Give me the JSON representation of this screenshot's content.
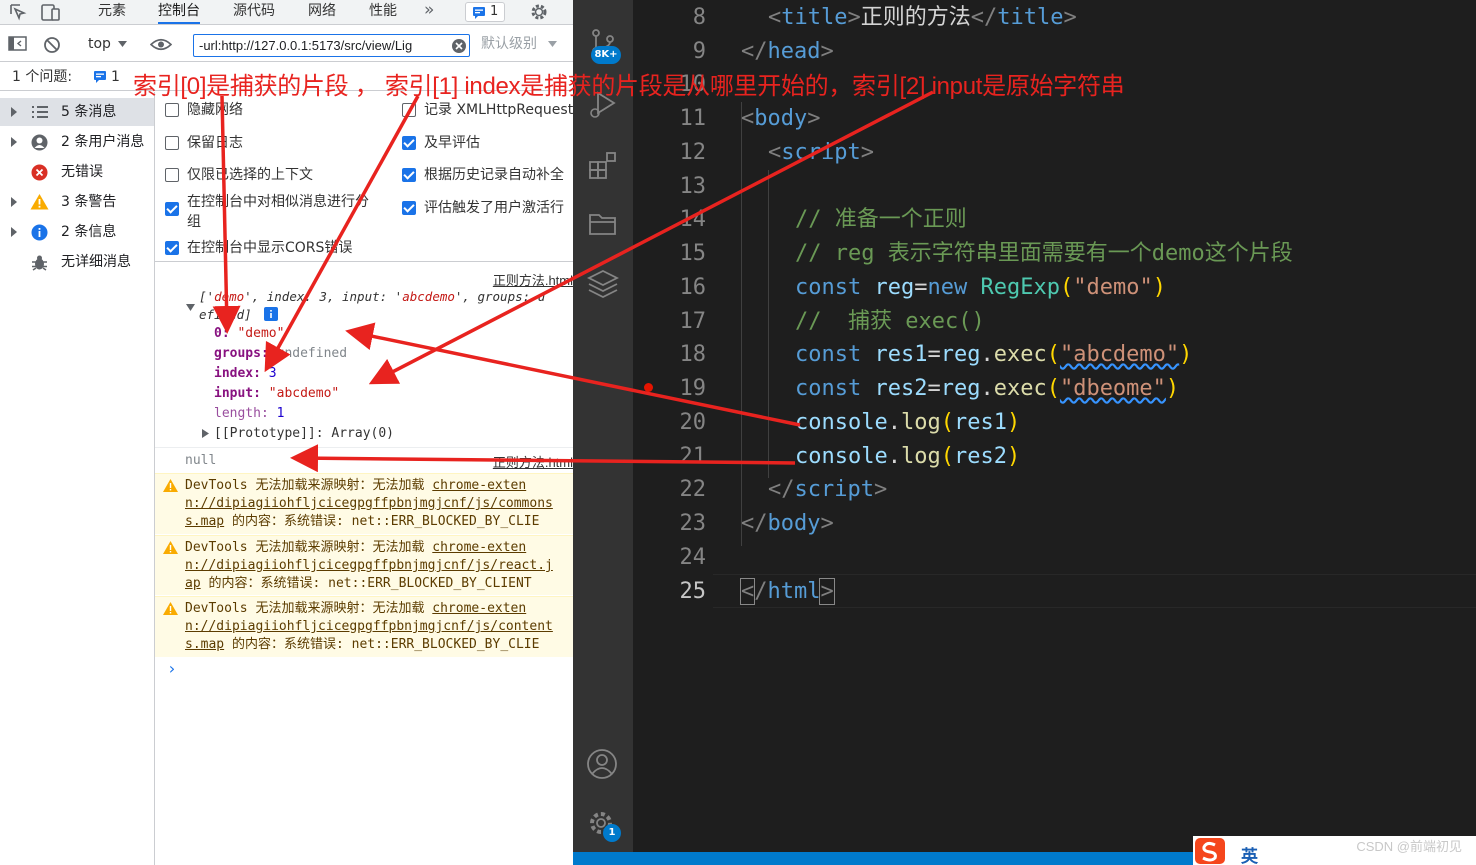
{
  "devtools": {
    "tabs": [
      {
        "label": "元素"
      },
      {
        "label": "控制台",
        "active": true
      },
      {
        "label": "源代码"
      },
      {
        "label": "网络"
      },
      {
        "label": "性能"
      }
    ],
    "more_tabs": "»",
    "issues_badge_count": "1",
    "toolbar": {
      "context": "top",
      "filter_value": "-url:http://127.0.0.1:5173/src/view/Lig",
      "level": "默认级别"
    },
    "issues_bar": {
      "label": "1 个问题:",
      "count": "1"
    },
    "sidebar": [
      {
        "label": "5 条消息",
        "icon": "list-icon",
        "selected": true
      },
      {
        "label": "2 条用户消息",
        "icon": "user-icon"
      },
      {
        "label": "无错误",
        "icon": "error-icon"
      },
      {
        "label": "3 条警告",
        "icon": "warning-icon"
      },
      {
        "label": "2 条信息",
        "icon": "info-icon"
      },
      {
        "label": "无详细消息",
        "icon": "bug-icon"
      }
    ],
    "settings": {
      "hide_network": "隐藏网络",
      "log_xhr": "记录 XMLHttpRequest",
      "preserve_log": "保留日志",
      "eager_eval": "及早评估",
      "selected_context": "仅限已选择的上下文",
      "autocomplete": "根据历史记录自动补全",
      "group_similar_1": "在控制台中对相似消息进行分",
      "group_similar_2": "组",
      "user_activation": "评估触发了用户激活行",
      "show_cors": "在控制台中显示CORS错误"
    },
    "console": {
      "source_link": "正则方法.html",
      "summary_prefix": "['",
      "summary_demo": "demo",
      "summary_mid": "', index: 3, input: '",
      "summary_input": "abcdemo",
      "summary_rest": "', groups: u",
      "summary_cont": "efined]",
      "props": [
        {
          "key": "0",
          "value": "\"demo\""
        },
        {
          "key": "groups",
          "value": "undefined"
        },
        {
          "key": "index",
          "value": "3"
        },
        {
          "key": "input",
          "value": "\"abcdemo\""
        },
        {
          "key": "length",
          "value": "1"
        }
      ],
      "prototype": "[[Prototype]]: Array(0)",
      "null_line": "null",
      "warnings": [
        {
          "line1_text": "DevTools 无法加载来源映射：无法加载 ",
          "line1_link": "chrome-exten",
          "line2": "n://dipiagiiohfljcicegpgffpbnjmgjcnf/js/commons",
          "line3_link": "s.map",
          "line3_text": " 的内容：系统错误: net::ERR_BLOCKED_BY_CLIE"
        },
        {
          "line1_text": "DevTools 无法加载来源映射：无法加载 ",
          "line1_link": "chrome-exten",
          "line2": "n://dipiagiiohfljcicegpgffpbnjmgjcnf/js/react.j",
          "line3_link": "ap",
          "line3_text": " 的内容：系统错误: net::ERR_BLOCKED_BY_CLIENT"
        },
        {
          "line1_text": "DevTools 无法加载来源映射：无法加载 ",
          "line1_link": "chrome-exten",
          "line2": "n://dipiagiiohfljcicegpgffpbnjmgjcnf/js/content",
          "line3_link": "s.map",
          "line3_text": " 的内容：系统错误: net::ERR_BLOCKED_BY_CLIE"
        }
      ],
      "prompt": "›"
    }
  },
  "vscode": {
    "activity_badges": {
      "source_control": "8K+",
      "settings": "1"
    },
    "line_numbers": [
      "8",
      "9",
      "10",
      "11",
      "12",
      "13",
      "14",
      "15",
      "16",
      "17",
      "18",
      "19",
      "20",
      "21",
      "22",
      "23",
      "24",
      "25"
    ],
    "code": {
      "l8_open": "title",
      "l8_text": "正则的方法",
      "l8_close": "title",
      "l9": "head",
      "l11": "body",
      "l12": "script",
      "l14": "// 准备一个正则",
      "l15": "// reg 表示字符串里面需要有一个demo这个片段",
      "l16_kw": "const",
      "l16_var": "reg",
      "l16_new": "new",
      "l16_cls": "RegExp",
      "l16_str": "\"demo\"",
      "l17": "//  捕获 exec()",
      "l18_var": "res1",
      "l18_str": "\"abcdemo\"",
      "l19_var": "res2",
      "l19_str": "\"dbeome\"",
      "console": "console",
      "log": "log",
      "exec": "exec",
      "l20_arg": "res1",
      "l21_arg": "res2",
      "l22": "script",
      "l23": "body",
      "l25": "html"
    },
    "watermark": "CSDN @前端初见",
    "ime_label": "英"
  },
  "annotation": {
    "text": "索引[0]是捕获的片段 ， 索引[1] index是捕获的片段是从哪里开始的，索引[2] input是原始字符串"
  },
  "colors": {
    "annotation_red": "#e8231f",
    "accent_blue": "#1a73e8"
  }
}
